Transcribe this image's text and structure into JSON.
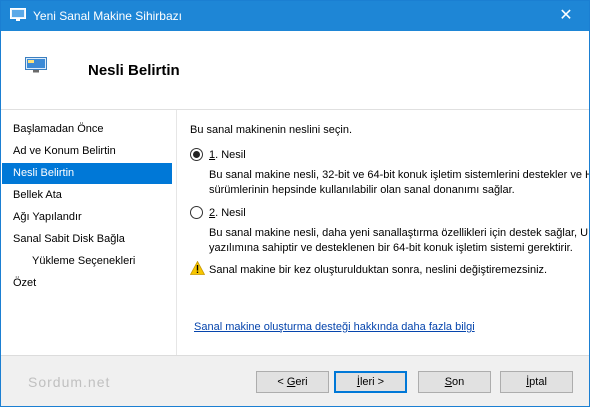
{
  "window": {
    "title": "Yeni Sanal Makine Sihirbazı",
    "close_glyph": "✕",
    "title_bar_color": "#1e86d6"
  },
  "header": {
    "title": "Nesli Belirtin",
    "icon": "monitor-icon"
  },
  "sidebar": {
    "items": [
      {
        "label": "Başlamadan Önce"
      },
      {
        "label": "Ad ve Konum Belirtin"
      },
      {
        "label": "Nesli Belirtin",
        "selected": true
      },
      {
        "label": "Bellek Ata"
      },
      {
        "label": "Ağı Yapılandır"
      },
      {
        "label": "Sanal Sabit Disk Bağla"
      },
      {
        "label": "Yükleme Seçenekleri",
        "sub": true
      },
      {
        "label": "Özet"
      }
    ],
    "selected_color": "#0078d7"
  },
  "main": {
    "prompt": "Bu sanal makinenin neslini seçin.",
    "options": [
      {
        "accel": "1",
        "label_rest": ". Nesil",
        "selected": true,
        "desc_line1": "Bu sanal makine nesli, 32-bit ve 64-bit konuk işletim sistemlerini destekler ve Hy",
        "desc_line2": "sürümlerinin hepsinde kullanılabilir olan sanal donanımı sağlar."
      },
      {
        "accel": "2",
        "label_rest": ". Nesil",
        "selected": false,
        "desc_line1": "Bu sanal makine nesli, daha yeni sanallaştırma özellikleri için destek sağlar, UEF",
        "desc_line2": "yazılımına sahiptir ve desteklenen bir 64-bit konuk işletim sistemi gerektirir."
      }
    ],
    "warning": "Sanal makine bir kez oluşturulduktan sonra, neslini değiştiremezsiniz.",
    "help_link": "Sanal makine oluşturma desteği hakkında daha fazla bilgi"
  },
  "footer": {
    "brand": "Sordum.net",
    "back": {
      "pre": "< ",
      "accel": "G",
      "rest": "eri"
    },
    "next": {
      "pre": "",
      "accel": "İ",
      "rest": "leri >"
    },
    "finish": {
      "pre": "",
      "accel": "S",
      "rest": "on"
    },
    "cancel": {
      "pre": "",
      "accel": "İ",
      "rest": "ptal"
    }
  }
}
